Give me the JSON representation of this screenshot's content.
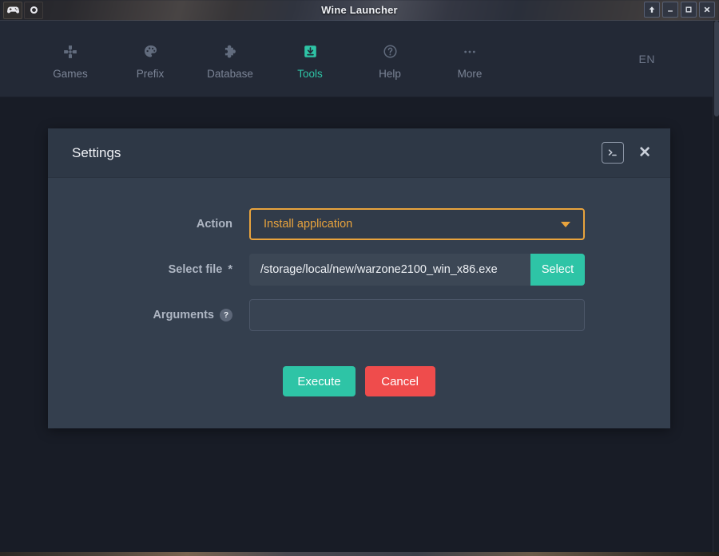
{
  "titlebar": {
    "title": "Wine Launcher",
    "left_buttons": [
      {
        "name": "gamepad-icon",
        "label": ""
      },
      {
        "name": "record-icon",
        "label": ""
      }
    ],
    "window_controls": [
      {
        "name": "rollup-button",
        "label": "↑"
      },
      {
        "name": "minimize-button",
        "label": "–"
      },
      {
        "name": "maximize-button",
        "label": "□"
      },
      {
        "name": "close-button",
        "label": "✕"
      }
    ]
  },
  "nav": {
    "items": [
      {
        "label": "Games",
        "icon": "dpad-icon",
        "active": false
      },
      {
        "label": "Prefix",
        "icon": "palette-icon",
        "active": false
      },
      {
        "label": "Database",
        "icon": "puzzle-icon",
        "active": false
      },
      {
        "label": "Tools",
        "icon": "download-box-icon",
        "active": true
      },
      {
        "label": "Help",
        "icon": "question-circle-icon",
        "active": false
      },
      {
        "label": "More",
        "icon": "ellipsis-icon",
        "active": false
      }
    ],
    "language": "EN"
  },
  "dialog": {
    "title": "Settings",
    "terminal_button": "terminal-icon",
    "close_button": "✕",
    "fields": {
      "action": {
        "label": "Action",
        "value": "Install application",
        "options": [
          "Install application"
        ]
      },
      "select_file": {
        "label": "Select file",
        "required_marker": "*",
        "value": "/storage/local/new/warzone2100_win_x86.exe",
        "placeholder": "",
        "button_label": "Select"
      },
      "arguments": {
        "label": "Arguments",
        "help_marker": "?",
        "value": "",
        "placeholder": ""
      }
    },
    "actions": {
      "execute_label": "Execute",
      "cancel_label": "Cancel"
    }
  },
  "colors": {
    "accent_teal": "#2ec4a6",
    "accent_amber": "#e8a33d",
    "danger_red": "#ef4c4c",
    "dialog_bg": "#343f4e",
    "app_bg": "#181c26",
    "nav_bg": "#232936"
  }
}
